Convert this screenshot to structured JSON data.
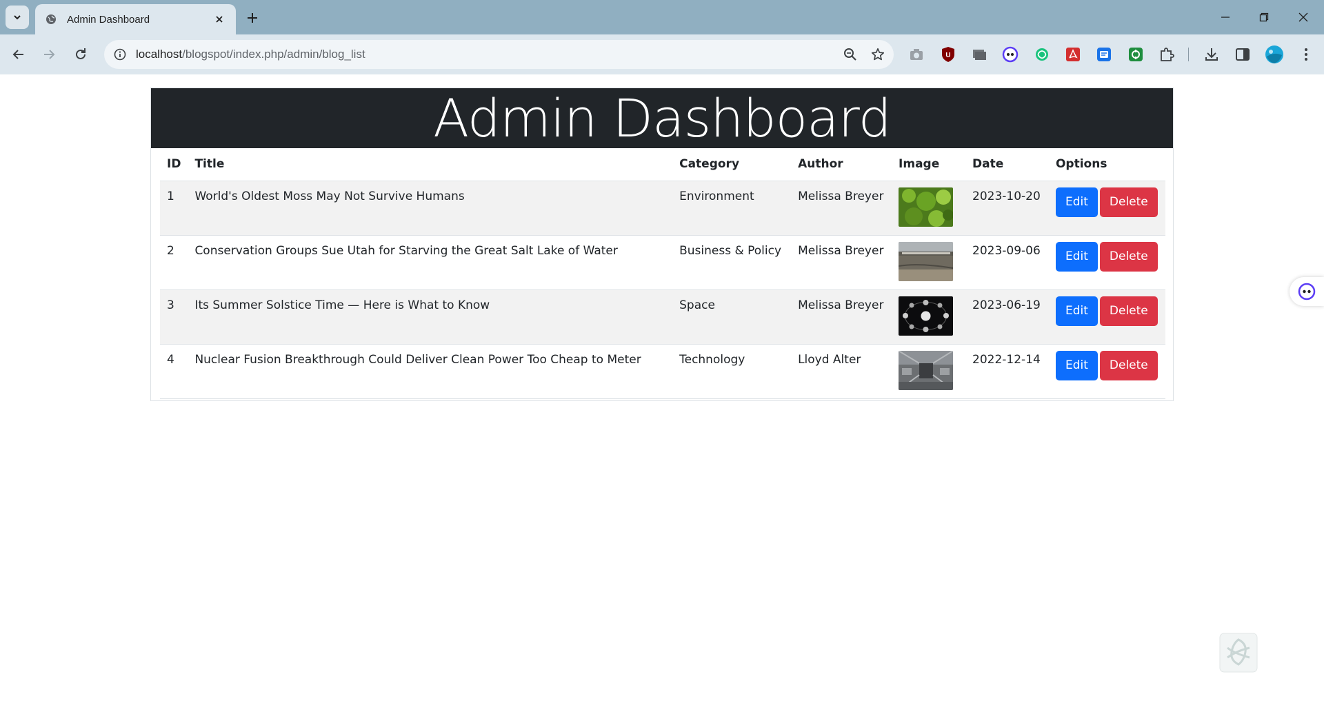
{
  "browser": {
    "tab_title": "Admin Dashboard",
    "url_host": "localhost",
    "url_path": "/blogspot/index.php/admin/blog_list"
  },
  "page": {
    "heading": "Admin Dashboard",
    "columns": [
      "ID",
      "Title",
      "Category",
      "Author",
      "Image",
      "Date",
      "Options"
    ],
    "rows": [
      {
        "id": "1",
        "title": "World's Oldest Moss May Not Survive Humans",
        "category": "Environment",
        "author": "Melissa Breyer",
        "date": "2023-10-20",
        "image": "moss-image"
      },
      {
        "id": "2",
        "title": "Conservation Groups Sue Utah for Starving the Great Salt Lake of Water",
        "category": "Business & Policy",
        "author": "Melissa Breyer",
        "date": "2023-09-06",
        "image": "lake-image"
      },
      {
        "id": "3",
        "title": "Its Summer Solstice Time — Here is What to Know",
        "category": "Space",
        "author": "Melissa Breyer",
        "date": "2023-06-19",
        "image": "solstice-image"
      },
      {
        "id": "4",
        "title": "Nuclear Fusion Breakthrough Could Deliver Clean Power Too Cheap to Meter",
        "category": "Technology",
        "author": "Lloyd Alter",
        "date": "2022-12-14",
        "image": "fusion-image"
      }
    ],
    "edit_label": "Edit",
    "delete_label": "Delete"
  },
  "colors": {
    "header_bg": "#212529",
    "edit_btn": "#0d6efd",
    "delete_btn": "#dc3545",
    "tabbar_bg": "#90afc1"
  }
}
